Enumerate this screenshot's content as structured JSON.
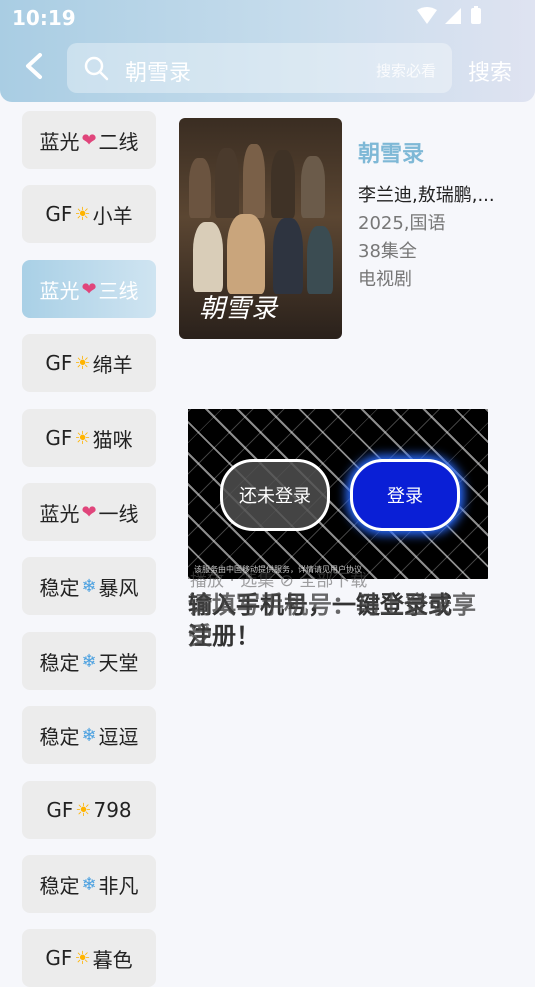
{
  "status": {
    "time": "10:19",
    "icons": "▾◢▮"
  },
  "search": {
    "query": "朝雪录",
    "hint": "搜索必看",
    "button": "搜索"
  },
  "sidebar": {
    "items": [
      {
        "a": "蓝光",
        "sym": "❤",
        "b": "二线",
        "kind": "heart"
      },
      {
        "a": "GF",
        "sym": "☀",
        "b": "小羊",
        "kind": "sun"
      },
      {
        "a": "蓝光",
        "sym": "❤",
        "b": "三线",
        "kind": "heart"
      },
      {
        "a": "GF",
        "sym": "☀",
        "b": "绵羊",
        "kind": "sun"
      },
      {
        "a": "GF",
        "sym": "☀",
        "b": "猫咪",
        "kind": "sun"
      },
      {
        "a": "蓝光",
        "sym": "❤",
        "b": "一线",
        "kind": "heart"
      },
      {
        "a": "稳定",
        "sym": "❄",
        "b": "暴风",
        "kind": "snow"
      },
      {
        "a": "稳定",
        "sym": "❄",
        "b": "天堂",
        "kind": "snow"
      },
      {
        "a": "稳定",
        "sym": "❄",
        "b": "逗逗",
        "kind": "snow"
      },
      {
        "a": "GF",
        "sym": "☀",
        "b": "798",
        "kind": "sun"
      },
      {
        "a": "稳定",
        "sym": "❄",
        "b": "非凡",
        "kind": "snow"
      },
      {
        "a": "GF",
        "sym": "☀",
        "b": "暮色",
        "kind": "sun"
      }
    ],
    "active_index": 2
  },
  "result": {
    "title": "朝雪录",
    "poster_caption": "朝雪录",
    "cast": "李兰迪,敖瑞鹏,...",
    "year_lang": "2025,国语",
    "episodes": "38集全",
    "type": "电视剧"
  },
  "overlay": {
    "not_logged": "还未登录",
    "login": "登录",
    "footer": "该服务由中国移动提供服务，详情请见用户协议"
  },
  "ghost_row": "播放  · 选集  ⊘ 全部下载",
  "message": {
    "line1": "输入手机号，一键登录或",
    "line2": "注册！",
    "overlap": "请填写手机号：马上登录享受"
  },
  "colors": {
    "accent": "#7eb8d6",
    "login_blue": "#0a1fd6",
    "heart": "#e0457b",
    "sun": "#ffb400",
    "snow": "#4aa0e0"
  }
}
